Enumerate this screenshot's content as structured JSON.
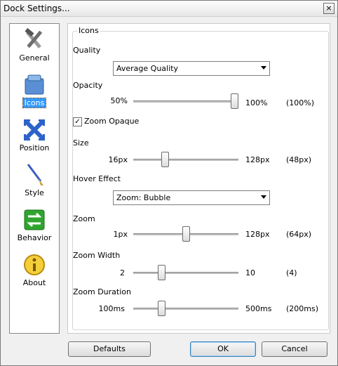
{
  "window": {
    "title": "Dock Settings...",
    "close_label": "×"
  },
  "sidebar": {
    "items": [
      {
        "label": "General",
        "icon": "tools-icon"
      },
      {
        "label": "Icons",
        "icon": "icons-icon"
      },
      {
        "label": "Position",
        "icon": "arrows-icon"
      },
      {
        "label": "Style",
        "icon": "brush-icon"
      },
      {
        "label": "Behavior",
        "icon": "exchange-icon"
      },
      {
        "label": "About",
        "icon": "info-icon"
      }
    ],
    "selected": "Icons"
  },
  "icons_group": {
    "title": "Icons",
    "quality": {
      "label": "Quality",
      "value": "Average Quality"
    },
    "opacity": {
      "label": "Opacity",
      "min": "50%",
      "max": "100%",
      "current": "(100%)",
      "level": 1.0
    },
    "zoom_opaque": {
      "label": "Zoom Opaque",
      "checked": true
    },
    "size": {
      "label": "Size",
      "min": "16px",
      "max": "128px",
      "current": "(48px)",
      "level": 0.29
    },
    "hover_effect": {
      "label": "Hover Effect",
      "value": "Zoom: Bubble"
    },
    "zoom": {
      "label": "Zoom",
      "min": "1px",
      "max": "128px",
      "current": "(64px)",
      "level": 0.5
    },
    "zoom_width": {
      "label": "Zoom Width",
      "min": "2",
      "max": "10",
      "current": "(4)",
      "level": 0.25
    },
    "zoom_duration": {
      "label": "Zoom Duration",
      "min": "100ms",
      "max": "500ms",
      "current": "(200ms)",
      "level": 0.25
    }
  },
  "buttons": {
    "defaults": "Defaults",
    "ok": "OK",
    "cancel": "Cancel"
  }
}
